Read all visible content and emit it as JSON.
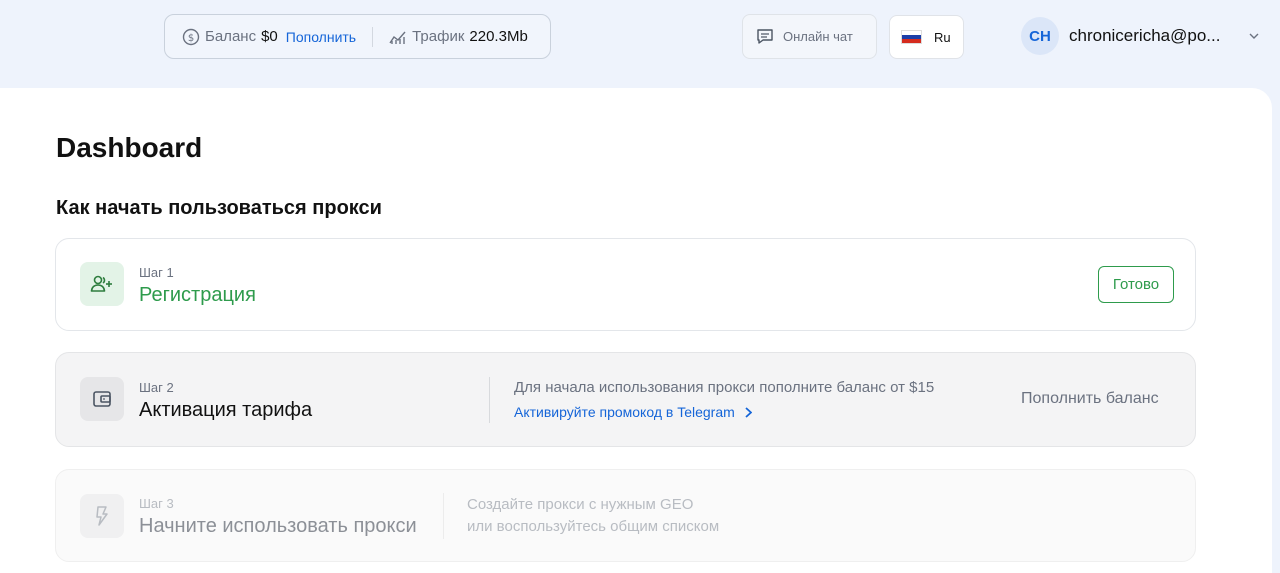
{
  "header": {
    "balance_label": "Баланс",
    "balance_value": "$0",
    "topup_link": "Пополнить",
    "traffic_label": "Трафик",
    "traffic_value": "220.3Mb",
    "chat_label": "Онлайн чат",
    "language": "Ru",
    "avatar_initials": "CH",
    "user_email": "chronicericha@po..."
  },
  "main": {
    "title": "Dashboard",
    "section_title": "Как начать пользоваться прокси",
    "steps": [
      {
        "number": "Шаг 1",
        "name": "Регистрация",
        "status_button": "Готово"
      },
      {
        "number": "Шаг 2",
        "name": "Активация тарифа",
        "description": "Для начала использования прокси пополните баланс от $15",
        "promo_link": "Активируйте промокод в Telegram",
        "action": "Пополнить баланс"
      },
      {
        "number": "Шаг 3",
        "name": "Начните использовать прокси",
        "description_line1": "Создайте прокси с нужным GEO",
        "description_line2": "или воспользуйтесь общим списком"
      }
    ]
  },
  "colors": {
    "accent_blue": "#1565d8",
    "success_green": "#2e9b4c"
  },
  "icons": {
    "balance": "dollar-circle-icon",
    "traffic": "chart-trend-icon",
    "chat": "chat-bubble-icon",
    "flag": "russia-flag-icon",
    "dropdown": "chevron-down-icon",
    "step1": "user-add-icon",
    "step2": "wallet-icon",
    "step3": "lightning-icon",
    "promo": "chevron-right-icon"
  }
}
